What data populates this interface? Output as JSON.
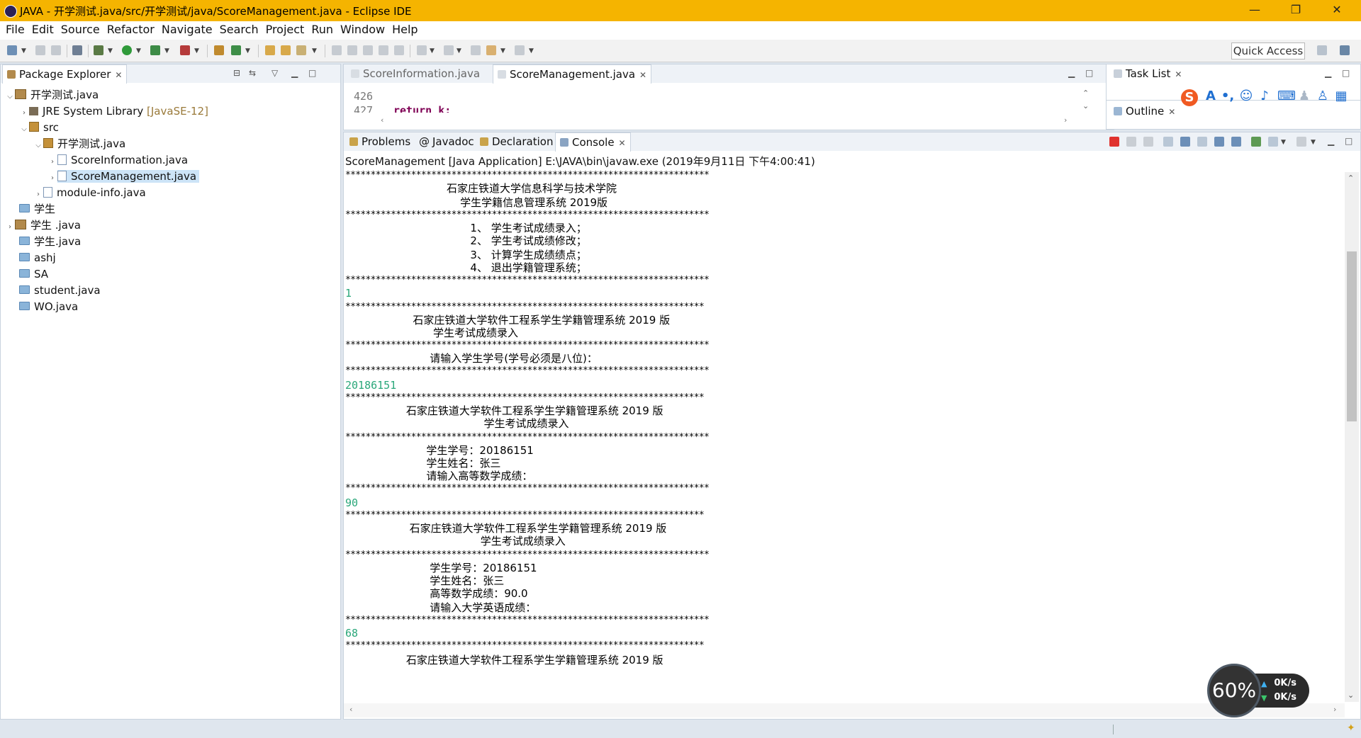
{
  "window": {
    "title": "JAVA - 开学测试.java/src/开学测试/java/ScoreManagement.java - Eclipse IDE",
    "minimize": "—",
    "maximize": "❐",
    "close": "✕"
  },
  "menu": [
    "File",
    "Edit",
    "Source",
    "Refactor",
    "Navigate",
    "Search",
    "Project",
    "Run",
    "Window",
    "Help"
  ],
  "toolbar": {
    "quick_access": "Quick Access"
  },
  "package_explorer": {
    "tab_label": "Package Explorer",
    "items": [
      {
        "label": "开学测试.java"
      },
      {
        "label": "JRE System Library",
        "decoration": "[JavaSE-12]"
      },
      {
        "label": "src"
      },
      {
        "label": "开学测试.java"
      },
      {
        "label": "ScoreInformation.java"
      },
      {
        "label": "ScoreManagement.java"
      },
      {
        "label": "module-info.java"
      },
      {
        "label": "学生"
      },
      {
        "label": "学生 .java"
      },
      {
        "label": "学生.java"
      },
      {
        "label": "ashj"
      },
      {
        "label": "SA"
      },
      {
        "label": "student.java"
      },
      {
        "label": "WO.java"
      }
    ]
  },
  "editor": {
    "tabs": [
      {
        "label": "ScoreInformation.java"
      },
      {
        "label": "ScoreManagement.java"
      }
    ],
    "lines": [
      {
        "num": "426",
        "code": ""
      },
      {
        "num": "427",
        "code": "    return k;"
      }
    ]
  },
  "task_list": {
    "tab_label": "Task List"
  },
  "outline": {
    "tab_label": "Outline"
  },
  "console_panel": {
    "tabs": [
      {
        "label": "Problems"
      },
      {
        "label": "Javadoc"
      },
      {
        "label": "Declaration"
      },
      {
        "label": "Console"
      }
    ],
    "launch_info": "ScoreManagement [Java Application] E:\\JAVA\\bin\\javaw.exe (2019年9月11日 下午4:00:41)",
    "lines": [
      {
        "text": "************************************************************************",
        "kind": "stars"
      },
      {
        "text": "                              石家庄铁道大学信息科学与技术学院",
        "kind": "text"
      },
      {
        "text": "                                  学生学籍信息管理系统 2019版",
        "kind": "text"
      },
      {
        "text": "************************************************************************",
        "kind": "stars"
      },
      {
        "text": "                                     1、 学生考试成绩录入；",
        "kind": "text"
      },
      {
        "text": "                                     2、 学生考试成绩修改；",
        "kind": "text"
      },
      {
        "text": "                                     3、 计算学生成绩绩点；",
        "kind": "text"
      },
      {
        "text": "                                     4、 退出学籍管理系统；",
        "kind": "text"
      },
      {
        "text": "************************************************************************",
        "kind": "stars"
      },
      {
        "text": "1",
        "kind": "input"
      },
      {
        "text": "***********************************************************************",
        "kind": "stars"
      },
      {
        "text": "                    石家庄铁道大学软件工程系学生学籍管理系统 2019 版",
        "kind": "text"
      },
      {
        "text": "                          学生考试成绩录入",
        "kind": "text"
      },
      {
        "text": "************************************************************************",
        "kind": "stars"
      },
      {
        "text": "                         请输入学生学号(学号必须是八位)：",
        "kind": "text"
      },
      {
        "text": "************************************************************************",
        "kind": "stars"
      },
      {
        "text": "20186151",
        "kind": "input"
      },
      {
        "text": "***********************************************************************",
        "kind": "stars"
      },
      {
        "text": "                  石家庄铁道大学软件工程系学生学籍管理系统 2019 版",
        "kind": "text"
      },
      {
        "text": "                                         学生考试成绩录入",
        "kind": "text"
      },
      {
        "text": "************************************************************************",
        "kind": "stars"
      },
      {
        "text": "                        学生学号：20186151",
        "kind": "text"
      },
      {
        "text": "                        学生姓名：张三",
        "kind": "text"
      },
      {
        "text": "                        请输入高等数学成绩：",
        "kind": "text"
      },
      {
        "text": "************************************************************************",
        "kind": "stars"
      },
      {
        "text": "90",
        "kind": "input"
      },
      {
        "text": "***********************************************************************",
        "kind": "stars"
      },
      {
        "text": "                   石家庄铁道大学软件工程系学生学籍管理系统 2019 版",
        "kind": "text"
      },
      {
        "text": "                                        学生考试成绩录入",
        "kind": "text"
      },
      {
        "text": "************************************************************************",
        "kind": "stars"
      },
      {
        "text": "                         学生学号：20186151",
        "kind": "text"
      },
      {
        "text": "                         学生姓名：张三",
        "kind": "text"
      },
      {
        "text": "                         高等数学成绩：90.0",
        "kind": "text"
      },
      {
        "text": "                         请输入大学英语成绩：",
        "kind": "text"
      },
      {
        "text": "************************************************************************",
        "kind": "stars"
      },
      {
        "text": "68",
        "kind": "input"
      },
      {
        "text": "***********************************************************************",
        "kind": "stars"
      },
      {
        "text": "                  石家庄铁道大学软件工程系学生学籍管理系统 2019 版",
        "kind": "text"
      }
    ]
  },
  "speed_widget": {
    "percent": "60%",
    "up": "0K/s",
    "down": "0K/s"
  },
  "colors": {
    "title_bar": "#f5b400",
    "console_input": "#2aa77a",
    "selection": "#cde4f7"
  }
}
